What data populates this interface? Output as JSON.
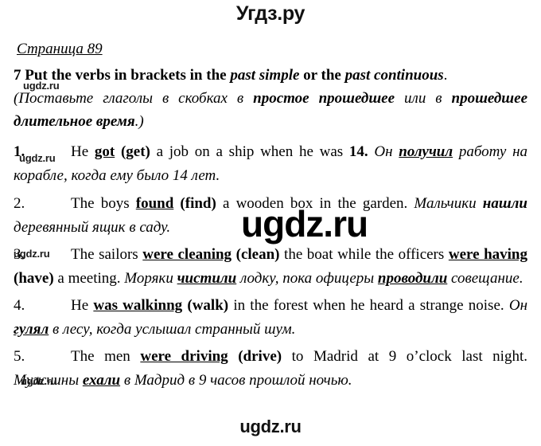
{
  "site": {
    "logo_text": "Угдз.ру",
    "bottom_watermark": "ugdz.ru",
    "watermark_text": "ugdz.ru"
  },
  "page": {
    "heading": "Страница 89"
  },
  "task": {
    "number": "7",
    "en_part1": "Put the verbs in brackets in the ",
    "en_italic1": "past simple",
    "en_part2": " or the ",
    "en_italic2": "past continuous",
    "en_part3": ".",
    "ru_part1": "(Поставьте глаголы в скобках в ",
    "ru_bold1": "простое прошедшее",
    "ru_part2": " или в ",
    "ru_bold2": "прошедшее длительное время",
    "ru_part3": ".)"
  },
  "exercises": [
    {
      "number": "1.",
      "en": [
        {
          "text": "He ",
          "style": "plain"
        },
        {
          "text": "got",
          "style": "bold-underline"
        },
        {
          "text": " (get)",
          "style": "bold"
        },
        {
          "text": " a job on a ship when he was ",
          "style": "plain"
        },
        {
          "text": "14.",
          "style": "bold"
        }
      ],
      "ru": [
        {
          "text": " Он ",
          "style": "italic"
        },
        {
          "text": "получил",
          "style": "italic-bold-underline"
        },
        {
          "text": " работу на корабле, когда ему было 14 лет.",
          "style": "italic"
        }
      ]
    },
    {
      "number": "2.",
      "en": [
        {
          "text": "The boys ",
          "style": "plain"
        },
        {
          "text": "found",
          "style": "bold-underline"
        },
        {
          "text": " (find)",
          "style": "bold"
        },
        {
          "text": " a wooden box in the garden.",
          "style": "plain"
        }
      ],
      "ru": [
        {
          "text": "  Мальчики ",
          "style": "italic"
        },
        {
          "text": "нашли",
          "style": "italic-bold"
        },
        {
          "text": " деревянный ящик в саду.",
          "style": "italic"
        }
      ]
    },
    {
      "number": "3.",
      "en": [
        {
          "text": "The sailors ",
          "style": "plain"
        },
        {
          "text": "were cleaning",
          "style": "bold-underline"
        },
        {
          "text": " (clean)",
          "style": "bold"
        },
        {
          "text": " the boat while the officers ",
          "style": "plain"
        },
        {
          "text": "were having",
          "style": "bold-underline"
        },
        {
          "text": " (have)",
          "style": "bold"
        },
        {
          "text": " a meeting.",
          "style": "plain"
        }
      ],
      "ru": [
        {
          "text": " Моряки ",
          "style": "italic"
        },
        {
          "text": "чистили",
          "style": "italic-bold-underline"
        },
        {
          "text": " лодку, пока офицеры ",
          "style": "italic"
        },
        {
          "text": "проводили",
          "style": "italic-bold-underline"
        },
        {
          "text": " совещание.",
          "style": "italic"
        }
      ]
    },
    {
      "number": "4.",
      "en": [
        {
          "text": "He ",
          "style": "plain"
        },
        {
          "text": "was walkinng",
          "style": "bold-underline"
        },
        {
          "text": " (walk)",
          "style": "bold"
        },
        {
          "text": " in the forest when he heard a strange noise.",
          "style": "plain"
        }
      ],
      "ru": [
        {
          "text": " Он ",
          "style": "italic"
        },
        {
          "text": "гулял",
          "style": "italic-bold-underline"
        },
        {
          "text": " в лесу, когда услышал странный шум.",
          "style": "italic"
        }
      ]
    },
    {
      "number": "5.",
      "en": [
        {
          "text": "The men ",
          "style": "plain"
        },
        {
          "text": "were driving",
          "style": "bold-underline"
        },
        {
          "text": " (drive)",
          "style": "bold"
        },
        {
          "text": " to Madrid at 9 o’clock last night.",
          "style": "plain"
        }
      ],
      "ru": [
        {
          "text": " Мужчины ",
          "style": "italic"
        },
        {
          "text": "ехали",
          "style": "italic-bold-underline"
        },
        {
          "text": " в Мадрид в 9 часов прошлой ночью.",
          "style": "italic"
        }
      ]
    }
  ]
}
